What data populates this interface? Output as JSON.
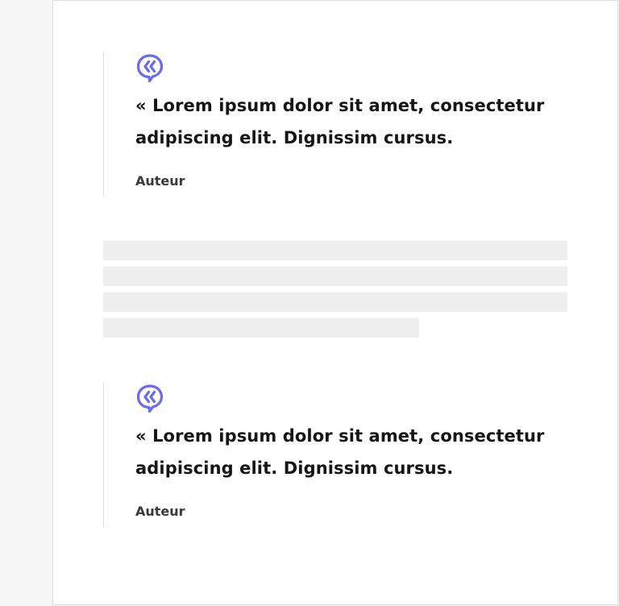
{
  "colors": {
    "accent": "#6a6af4",
    "text": "#161616",
    "author": "#3a3a3a",
    "placeholder": "#eeeeee",
    "border": "#dddddd"
  },
  "quotes": [
    {
      "icon": "quote-icon",
      "text": "« Lorem ipsum dolor sit amet, consectetur adipiscing elit. Dignissim cursus.",
      "author": "Auteur"
    },
    {
      "icon": "quote-icon",
      "text": "« Lorem ipsum dolor sit amet, consectetur adipiscing elit. Dignissim cursus.",
      "author": "Auteur"
    }
  ]
}
